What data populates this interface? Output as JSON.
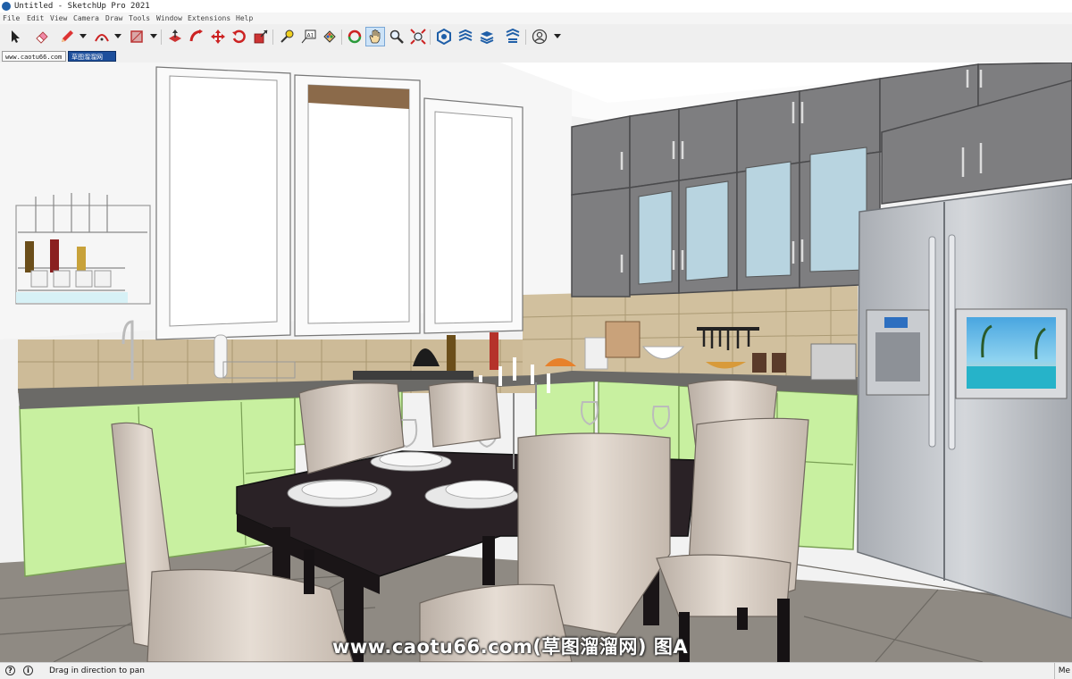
{
  "window": {
    "title": "Untitled - SketchUp Pro 2021"
  },
  "menu": {
    "items": [
      "File",
      "Edit",
      "View",
      "Camera",
      "Draw",
      "Tools",
      "Window",
      "Extensions",
      "Help"
    ]
  },
  "toolbar": {
    "tools": [
      {
        "icon": "select-arrow-icon"
      },
      {
        "icon": "eraser-icon"
      },
      {
        "icon": "pencil-line-icon",
        "dropdown": true
      },
      {
        "icon": "arc-icon",
        "dropdown": true
      },
      {
        "icon": "rectangle-shape-icon",
        "dropdown": true
      },
      {
        "icon": "push-pull-icon"
      },
      {
        "icon": "follow-me-icon"
      },
      {
        "icon": "move-icon"
      },
      {
        "icon": "rotate-icon"
      },
      {
        "icon": "scale-icon"
      },
      {
        "icon": "tape-measure-icon"
      },
      {
        "icon": "text-icon"
      },
      {
        "icon": "paint-bucket-icon"
      },
      {
        "icon": "orbit-icon"
      },
      {
        "icon": "pan-hand-icon",
        "active": true
      },
      {
        "icon": "zoom-icon"
      },
      {
        "icon": "zoom-extents-icon"
      },
      {
        "icon": "3d-warehouse-icon"
      },
      {
        "icon": "extension-warehouse-icon"
      },
      {
        "icon": "layout-icon"
      },
      {
        "icon": "extension-manager-icon"
      },
      {
        "icon": "account-icon",
        "dropdown": true
      }
    ]
  },
  "scene_tabs": [
    {
      "label": "www.caotu66.com",
      "selected": false
    },
    {
      "label": "草图溜溜网",
      "selected": true
    }
  ],
  "viewport": {
    "watermark": "www.caotu66.com(草图溜溜网) 图A"
  },
  "status": {
    "message": "Drag in direction to pan",
    "measurements_label": "Me"
  },
  "colors": {
    "accent": "#1d4f9c",
    "cabinet_lower": "#c8f0a0",
    "cabinet_upper": "#7e7e80",
    "table": "#2a2226",
    "chair": "#d9cfc6",
    "fridge": "#b9bcc2",
    "floor": "#8a8680"
  }
}
